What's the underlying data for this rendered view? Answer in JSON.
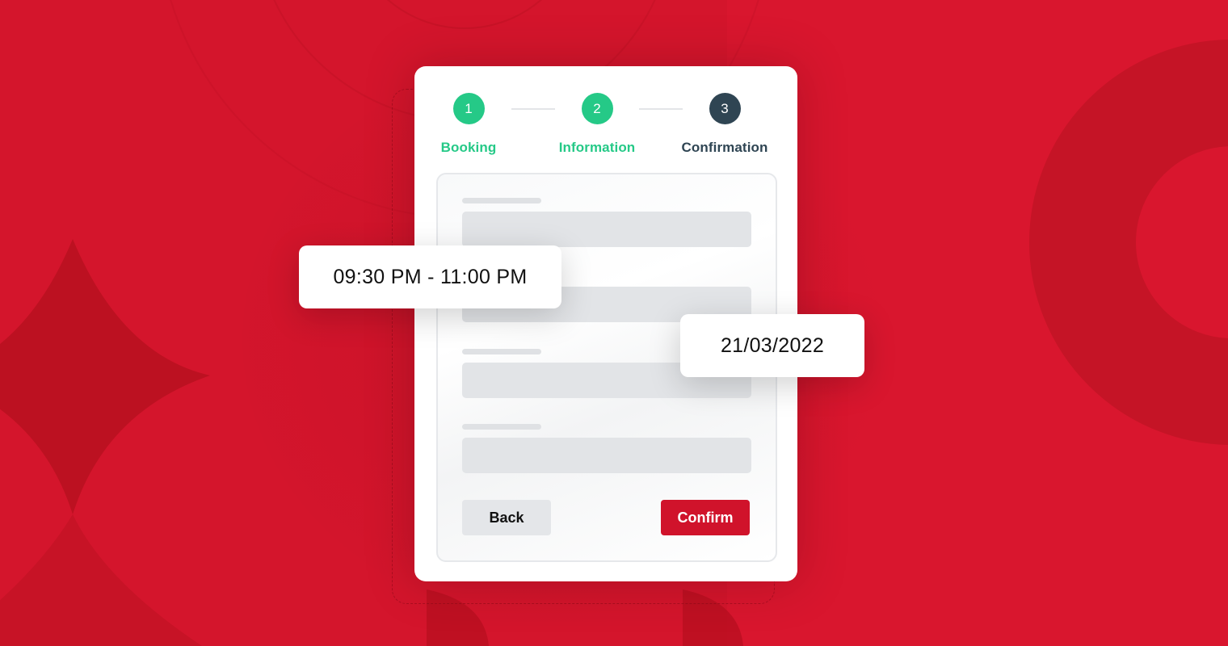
{
  "theme": {
    "background": "#d4152c",
    "accent_green": "#25c987",
    "step_active_dark": "#2f4553",
    "confirm_red": "#d0132b",
    "back_gray": "#e4e6e9"
  },
  "stepper": {
    "steps": [
      {
        "number": "1",
        "label": "Booking",
        "state": "completed",
        "color": "#25c987",
        "label_color": "#25c987"
      },
      {
        "number": "2",
        "label": "Information",
        "state": "completed",
        "color": "#25c987",
        "label_color": "#25c987"
      },
      {
        "number": "3",
        "label": "Confirmation",
        "state": "current",
        "color": "#2f4553",
        "label_color": "#2f4553"
      }
    ]
  },
  "form": {
    "fields_count": 4
  },
  "buttons": {
    "back_label": "Back",
    "confirm_label": "Confirm"
  },
  "popups": {
    "time_range": "09:30 PM - 11:00 PM",
    "date": "21/03/2022"
  }
}
